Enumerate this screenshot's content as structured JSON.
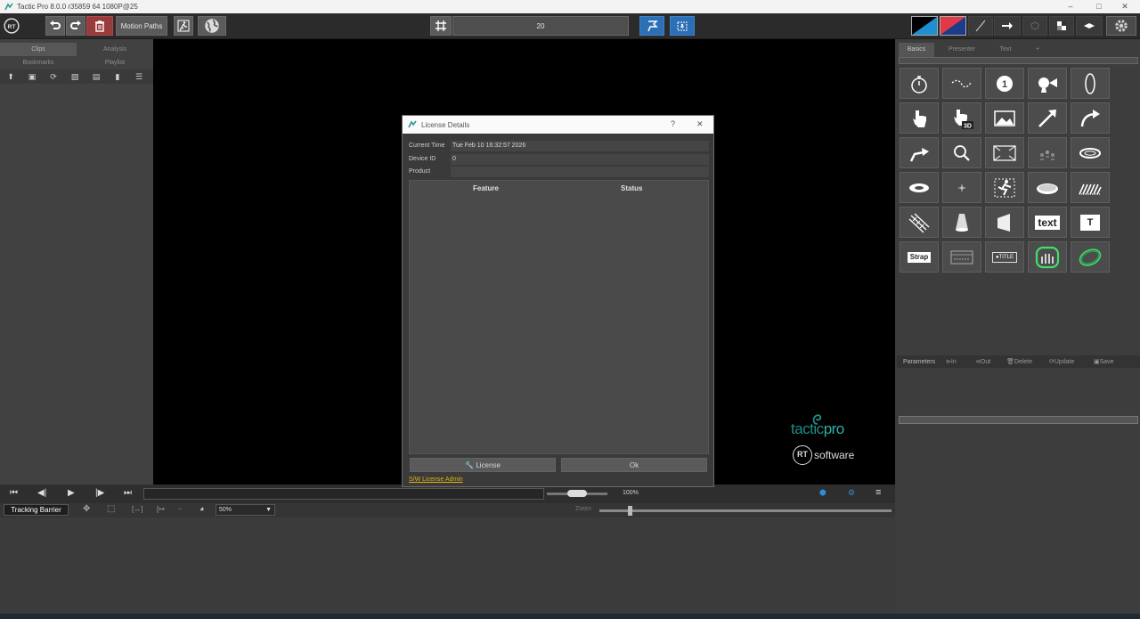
{
  "window": {
    "title": "Tactic Pro 8.0.0 r35859 64 1080P@25",
    "controls": [
      "–",
      "□",
      "✕"
    ]
  },
  "toolbar": {
    "motion_paths_label": "Motion Paths",
    "grid_value": "20",
    "colors": {
      "primary": "#1a1a1a",
      "secondary": "#e03a48",
      "accent": "#2d6fb4"
    }
  },
  "left_panel": {
    "tabs": [
      {
        "label": "Clips",
        "active": true
      },
      {
        "label": "Analysis",
        "active": false
      },
      {
        "label": "Bookmarks",
        "active": false
      },
      {
        "label": "Playlist",
        "active": false
      }
    ]
  },
  "viewer": {
    "brand_tactic": "tactic",
    "brand_pro": "pro",
    "brand_rt": "RT",
    "brand_software": "software"
  },
  "right_panel": {
    "tabs": [
      "Basics",
      "Presenter",
      "Text",
      "+"
    ],
    "tools": [
      "stopwatch-icon",
      "curvy-arrow-icon",
      "number-marker-icon",
      "spotlight-icon",
      "ellipse-icon",
      "pointer-hand-icon",
      "pointer-hand-3d-icon",
      "image-icon",
      "straight-arrow-icon",
      "curved-arrow-icon",
      "bent-arrow-icon",
      "magnifier-icon",
      "zoom-frame-icon",
      "player-group-icon",
      "ring-icon",
      "disk-ring-icon",
      "sparkle-icon",
      "player-cutout-icon",
      "ellipse-floor-icon",
      "hatched-area-icon",
      "lines-hatch-icon",
      "cone-light-icon",
      "wall-icon",
      "text-tool-icon",
      "pin-label-icon",
      "strap-icon",
      "lower-third-icon",
      "title-icon",
      "highlight-bars-icon",
      "circle-ring-icon"
    ],
    "text_tool_label": "text",
    "pin_label": "T",
    "strap_label": "Strap",
    "title_label": "●TITLE",
    "params": {
      "label": "Parameters",
      "in": "In",
      "out": "Out",
      "delete": "Delete",
      "update": "Update",
      "save": "Save"
    }
  },
  "transport": {
    "zoom_percent": "100%",
    "tracking_label": "Tracking Barrier",
    "zoom_select": "50%",
    "zoom_label": "Zoom"
  },
  "dialog": {
    "title": "License Details",
    "help": "?",
    "close": "✕",
    "current_time_label": "Current Time",
    "current_time_value": "Tue Feb 10 16:32:57 2026",
    "device_id_label": "Device ID",
    "device_id_value": "0",
    "product_label": "Product",
    "product_value": "",
    "table_headers": [
      "Feature",
      "Status"
    ],
    "license_button": "License",
    "ok_button": "Ok",
    "admin_link": "S/W License Admin"
  }
}
